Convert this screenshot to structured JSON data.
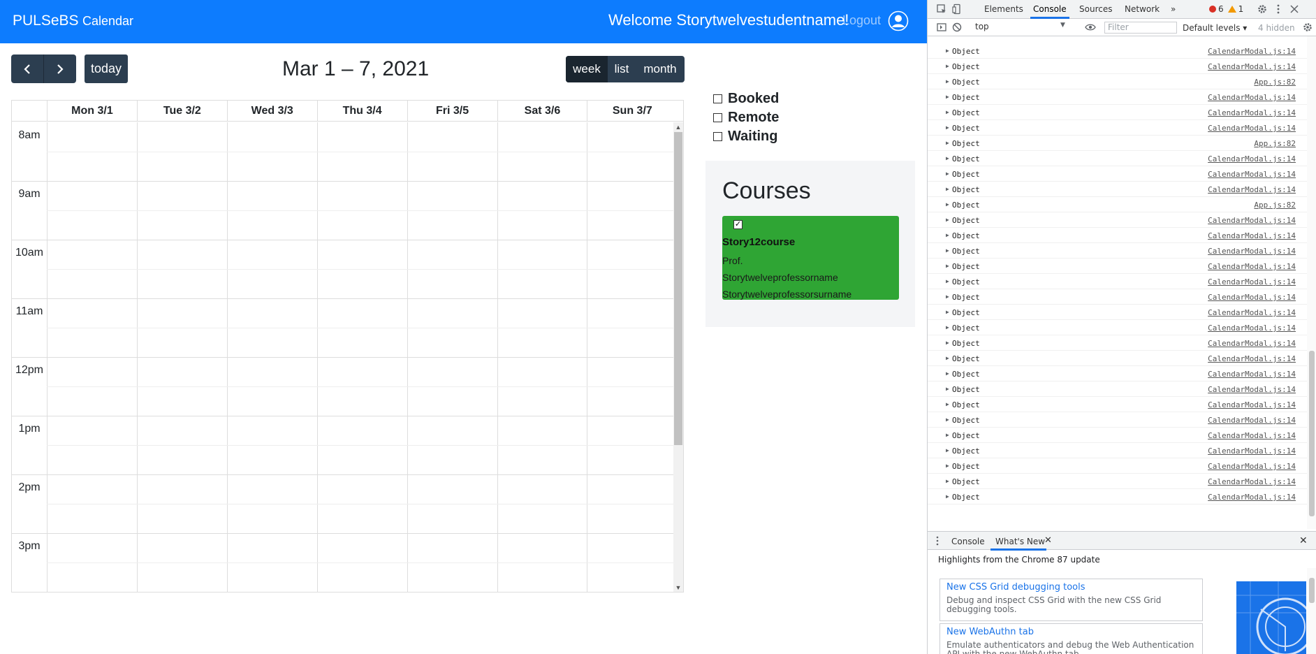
{
  "navbar": {
    "brand": "PULSeBS",
    "nav_link": "Calendar",
    "welcome": "Welcome Storytwelvestudentname!",
    "logout": "Logout"
  },
  "calendar": {
    "title": "Mar 1 – 7, 2021",
    "today_label": "today",
    "views": [
      "week",
      "list",
      "month"
    ],
    "active_view": "week",
    "days": [
      "Mon 3/1",
      "Tue 3/2",
      "Wed 3/3",
      "Thu 3/4",
      "Fri 3/5",
      "Sat 3/6",
      "Sun 3/7"
    ],
    "times": [
      "8am",
      "9am",
      "10am",
      "11am",
      "12pm",
      "1pm",
      "2pm",
      "3pm"
    ]
  },
  "filters": [
    "Booked",
    "Remote",
    "Waiting"
  ],
  "courses": {
    "heading": "Courses",
    "card": {
      "checked": true,
      "name": "Story12course",
      "professor_lines": [
        "Prof.",
        "Storytwelveprofessorname",
        "Storytwelveprofessorsurname"
      ]
    }
  },
  "devtools": {
    "tabs": [
      "Elements",
      "Console",
      "Sources",
      "Network"
    ],
    "active_tab": "Console",
    "more": "»",
    "errors": "6",
    "warnings": "1",
    "context": "top",
    "filter_placeholder": "Filter",
    "levels": "Default levels ▾",
    "hidden": "4 hidden",
    "console_rows": [
      {
        "text": "Object",
        "link": "CalendarModal.js:14"
      },
      {
        "text": "Object",
        "link": "CalendarModal.js:14"
      },
      {
        "text": "Object",
        "link": "App.js:82"
      },
      {
        "text": "Object",
        "link": "CalendarModal.js:14"
      },
      {
        "text": "Object",
        "link": "CalendarModal.js:14"
      },
      {
        "text": "Object",
        "link": "CalendarModal.js:14"
      },
      {
        "text": "Object",
        "link": "App.js:82"
      },
      {
        "text": "Object",
        "link": "CalendarModal.js:14"
      },
      {
        "text": "Object",
        "link": "CalendarModal.js:14"
      },
      {
        "text": "Object",
        "link": "CalendarModal.js:14"
      },
      {
        "text": "Object",
        "link": "App.js:82"
      },
      {
        "text": "Object",
        "link": "CalendarModal.js:14"
      },
      {
        "text": "Object",
        "link": "CalendarModal.js:14"
      },
      {
        "text": "Object",
        "link": "CalendarModal.js:14"
      },
      {
        "text": "Object",
        "link": "CalendarModal.js:14"
      },
      {
        "text": "Object",
        "link": "CalendarModal.js:14"
      },
      {
        "text": "Object",
        "link": "CalendarModal.js:14"
      },
      {
        "text": "Object",
        "link": "CalendarModal.js:14"
      },
      {
        "text": "Object",
        "link": "CalendarModal.js:14"
      },
      {
        "text": "Object",
        "link": "CalendarModal.js:14"
      },
      {
        "text": "Object",
        "link": "CalendarModal.js:14"
      },
      {
        "text": "Object",
        "link": "CalendarModal.js:14"
      },
      {
        "text": "Object",
        "link": "CalendarModal.js:14"
      },
      {
        "text": "Object",
        "link": "CalendarModal.js:14"
      },
      {
        "text": "Object",
        "link": "CalendarModal.js:14"
      },
      {
        "text": "Object",
        "link": "CalendarModal.js:14"
      },
      {
        "text": "Object",
        "link": "CalendarModal.js:14"
      },
      {
        "text": "Object",
        "link": "CalendarModal.js:14"
      },
      {
        "text": "Object",
        "link": "CalendarModal.js:14"
      },
      {
        "text": "Object",
        "link": "CalendarModal.js:14"
      }
    ],
    "drawer_tabs": [
      "Console",
      "What's New"
    ],
    "drawer_active": "What's New",
    "drawer_heading": "Highlights from the Chrome 87 update",
    "whats_new": [
      {
        "title": "New CSS Grid debugging tools",
        "desc": "Debug and inspect CSS Grid with the new CSS Grid debugging tools."
      },
      {
        "title": "New WebAuthn tab",
        "desc": "Emulate authenticators and debug the Web Authentication API with the new WebAuthn tab."
      }
    ]
  },
  "colors": {
    "navbar": "#0d7cfe",
    "button_dark": "#2c3e50",
    "course_card": "#2fa534",
    "devtools_accent": "#1a73e8"
  }
}
